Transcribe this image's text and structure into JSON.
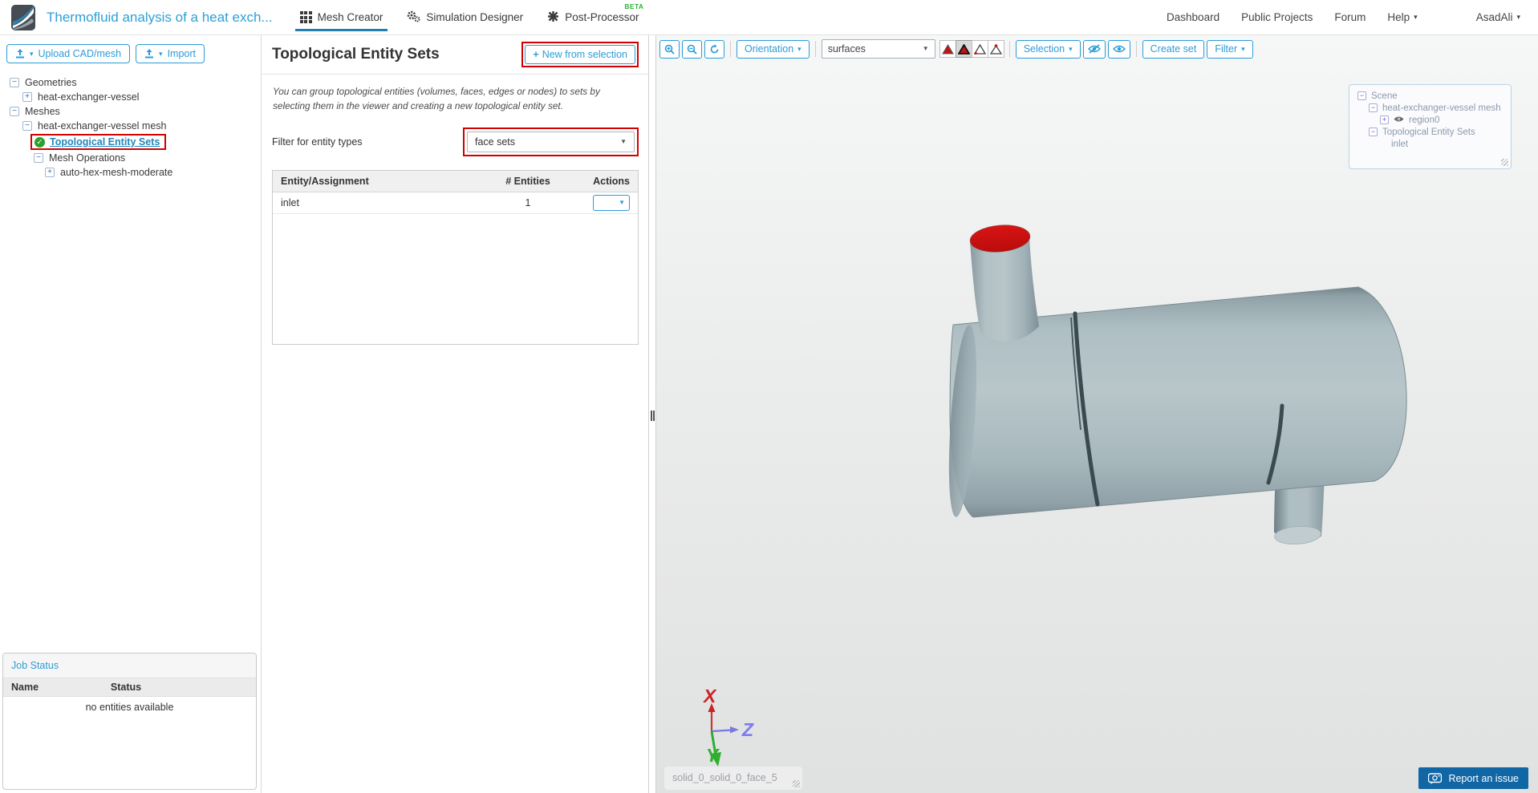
{
  "icons": {
    "caret_down": "▾",
    "select_caret": "▼",
    "plus": "+",
    "minus": "−",
    "check": "✓"
  },
  "header": {
    "project_title": "Thermofluid analysis of a heat exch...",
    "tabs": [
      {
        "label": "Mesh Creator"
      },
      {
        "label": "Simulation Designer"
      },
      {
        "label": "Post-Processor",
        "badge": "BETA"
      }
    ],
    "nav": [
      "Dashboard",
      "Public Projects",
      "Forum",
      "Help"
    ],
    "user": "AsadAli"
  },
  "sidebar": {
    "upload_label": "Upload CAD/mesh",
    "import_label": "Import",
    "tree": {
      "geometries": "Geometries",
      "geometry_item": "heat-exchanger-vessel",
      "meshes": "Meshes",
      "mesh_item": "heat-exchanger-vessel mesh",
      "topological_entity_sets": "Topological Entity Sets",
      "mesh_operations": "Mesh Operations",
      "operation_item": "auto-hex-mesh-moderate"
    },
    "job_status": {
      "title": "Job Status",
      "columns": [
        "Name",
        "Status"
      ],
      "empty_text": "no entities available"
    }
  },
  "panel": {
    "title": "Topological Entity Sets",
    "new_button": "New from selection",
    "description": "You can group topological entities (volumes, faces, edges or nodes) to sets by selecting them in the viewer and creating a new topological entity set.",
    "filter_label": "Filter for entity types",
    "filter_value": "face sets",
    "table": {
      "columns": [
        "Entity/Assignment",
        "# Entities",
        "Actions"
      ],
      "rows": [
        {
          "name": "inlet",
          "entities": "1"
        }
      ]
    }
  },
  "viewer": {
    "toolbar": {
      "orientation": "Orientation",
      "display_mode": "surfaces",
      "selection": "Selection",
      "create_set": "Create set",
      "filter": "Filter"
    },
    "scene_tree": {
      "root": "Scene",
      "mesh": "heat-exchanger-vessel mesh",
      "region": "region0",
      "sets_group": "Topological Entity Sets",
      "set_item": "inlet"
    },
    "axis": {
      "x": "X",
      "y": "Y",
      "z": "Z"
    },
    "face_label": "solid_0_solid_0_face_5",
    "report_button": "Report an issue"
  },
  "colors": {
    "accent": "#2b9cd8",
    "annotation_red": "#d40000",
    "beta_green": "#2eb135",
    "selected_face_red": "#cc1111",
    "model_body": "#aebfc3",
    "report_blue": "#1166a5"
  }
}
